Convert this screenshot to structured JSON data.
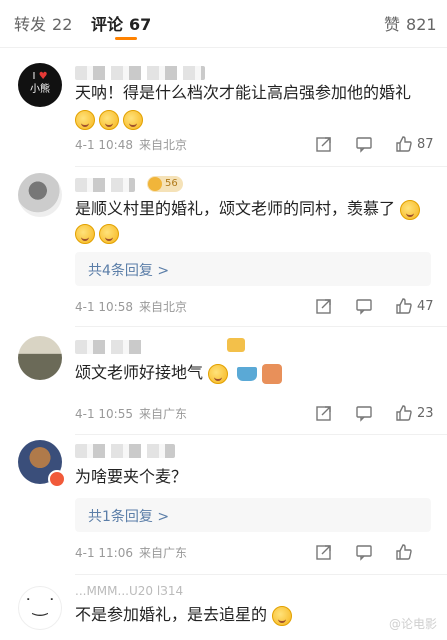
{
  "tabs": {
    "repost_label": "转发",
    "repost_count": "22",
    "comment_label": "评论",
    "comment_count": "67",
    "like_label": "赞",
    "like_count": "821"
  },
  "avatar1": {
    "line1": "I",
    "line2": "小熊"
  },
  "comments": [
    {
      "text": "天呐！得是什么档次才能让高启强参加他的婚礼",
      "time": "4-1 10:48",
      "location": "来自北京",
      "likes": "87"
    },
    {
      "text": "是顺义村里的婚礼，颂文老师的同村，羡慕了",
      "time": "4-1 10:58",
      "location": "来自北京",
      "likes": "47",
      "reply_link": "共4条回复 >"
    },
    {
      "text": "颂文老师好接地气",
      "time": "4-1 10:55",
      "location": "来自广东",
      "likes": "23"
    },
    {
      "text": "为啥要夹个麦？",
      "time": "4-1 11:06",
      "location": "来自广东",
      "likes": "",
      "reply_link": "共1条回复 >"
    },
    {
      "text": "不是参加婚礼，是去追星的"
    }
  ],
  "badge": "56",
  "username_partial": "...MMM...U20 lЗ14",
  "watermark": "@论电影"
}
